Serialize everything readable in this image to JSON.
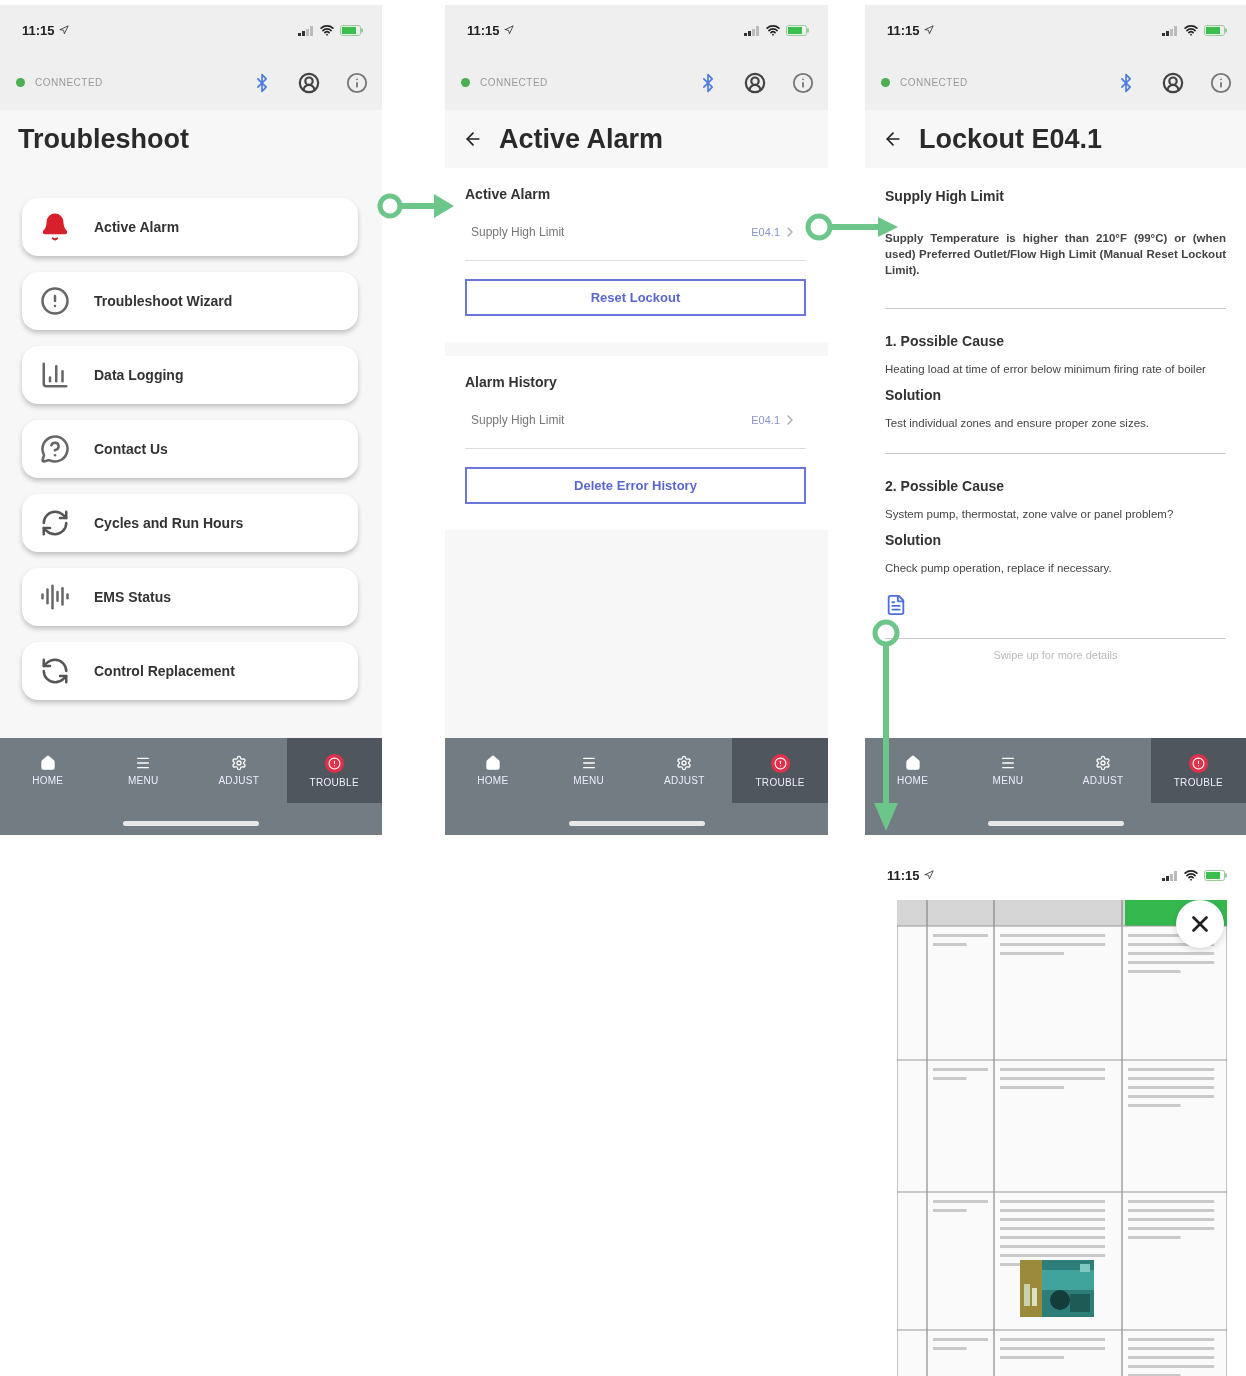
{
  "screens": [
    {
      "kind": "menu",
      "time": "11:15",
      "connection": "CONNECTED",
      "title": "Troubleshoot",
      "items": [
        {
          "label": "Active Alarm"
        },
        {
          "label": "Troubleshoot Wizard"
        },
        {
          "label": "Data Logging"
        },
        {
          "label": "Contact Us"
        },
        {
          "label": "Cycles and Run Hours"
        },
        {
          "label": "EMS Status"
        },
        {
          "label": "Control Replacement"
        }
      ],
      "nav": [
        {
          "label": "HOME",
          "selected": false
        },
        {
          "label": "MENU",
          "selected": false
        },
        {
          "label": "ADJUST",
          "selected": false
        },
        {
          "label": "TROUBLE",
          "selected": true
        }
      ]
    },
    {
      "kind": "alarm",
      "time": "11:15",
      "connection": "CONNECTED",
      "title": "Active Alarm",
      "sections": [
        {
          "heading": "Active Alarm",
          "row": {
            "label": "Supply High Limit",
            "code": "E04.1"
          },
          "button": "Reset Lockout"
        },
        {
          "heading": "Alarm History",
          "row": {
            "label": "Supply High Limit",
            "code": "E04.1"
          },
          "button": "Delete Error History"
        }
      ],
      "nav": [
        {
          "label": "HOME",
          "selected": false
        },
        {
          "label": "MENU",
          "selected": false
        },
        {
          "label": "ADJUST",
          "selected": false
        },
        {
          "label": "TROUBLE",
          "selected": true
        }
      ]
    },
    {
      "kind": "detail",
      "time": "11:15",
      "connection": "CONNECTED",
      "title": "Lockout E04.1",
      "subtitle": "Supply High Limit",
      "description": "Supply Temperature is higher than 210°F (99°C) or (when used) Preferred Outlet/Flow High Limit (Manual Reset Lockout Limit).",
      "causes": [
        {
          "heading": "1. Possible Cause",
          "text": "Heating load at time of error below minimum firing rate of boiler",
          "solution_label": "Solution",
          "solution": "Test individual zones and ensure proper zone sizes."
        },
        {
          "heading": "2. Possible Cause",
          "text": "System pump, thermostat, zone valve or panel problem?",
          "solution_label": "Solution",
          "solution": "Check pump operation, replace if necessary."
        }
      ],
      "hint": "Swipe up for more details",
      "nav": [
        {
          "label": "HOME",
          "selected": false
        },
        {
          "label": "MENU",
          "selected": false
        },
        {
          "label": "ADJUST",
          "selected": false
        },
        {
          "label": "TROUBLE",
          "selected": true
        }
      ]
    },
    {
      "kind": "document",
      "time": "11:15"
    }
  ]
}
